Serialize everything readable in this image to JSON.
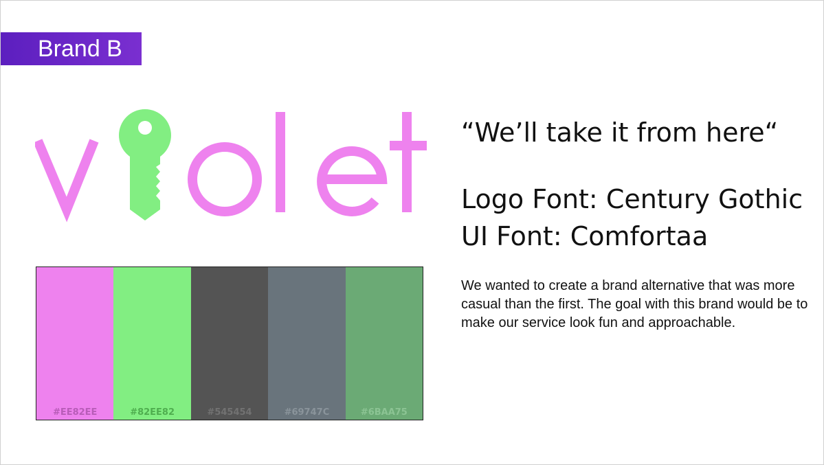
{
  "slide": {
    "brand_label": "Brand B",
    "tagline": "“We’ll take it from here“",
    "logo_font": "Logo Font: Century Gothic",
    "ui_font": "UI Font: Comfortaa",
    "description": "We wanted to create a brand alternative that was more casual than the first. The goal with this brand would be to make our service look fun and approachable."
  },
  "logo": {
    "word": "violet",
    "letter_color": "#EE82EE",
    "key_color": "#82EE82"
  },
  "palette": [
    {
      "hex": "#EE82EE",
      "color": "#EE82EE",
      "label_color": "#b85cb8"
    },
    {
      "hex": "#82EE82",
      "color": "#82EE82",
      "label_color": "#4fae4f"
    },
    {
      "hex": "#545454",
      "color": "#545454",
      "label_color": "#727272"
    },
    {
      "hex": "#69747C",
      "color": "#69747C",
      "label_color": "#8a949b"
    },
    {
      "hex": "#6BAA75",
      "color": "#6BAA75",
      "label_color": "#8cc494"
    }
  ]
}
